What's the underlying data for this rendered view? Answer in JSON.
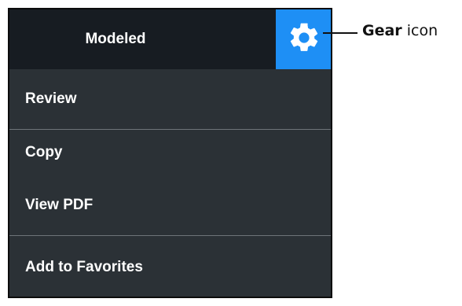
{
  "header": {
    "title": "Modeled",
    "gear_icon": "gear-icon",
    "accent_color": "#1e8ff5"
  },
  "menu": {
    "items": [
      {
        "label": "Review"
      },
      {
        "label": "Copy"
      },
      {
        "label": "View PDF"
      },
      {
        "label": "Add to Favorites"
      }
    ]
  },
  "callout": {
    "bold": "Gear",
    "rest": "icon"
  }
}
